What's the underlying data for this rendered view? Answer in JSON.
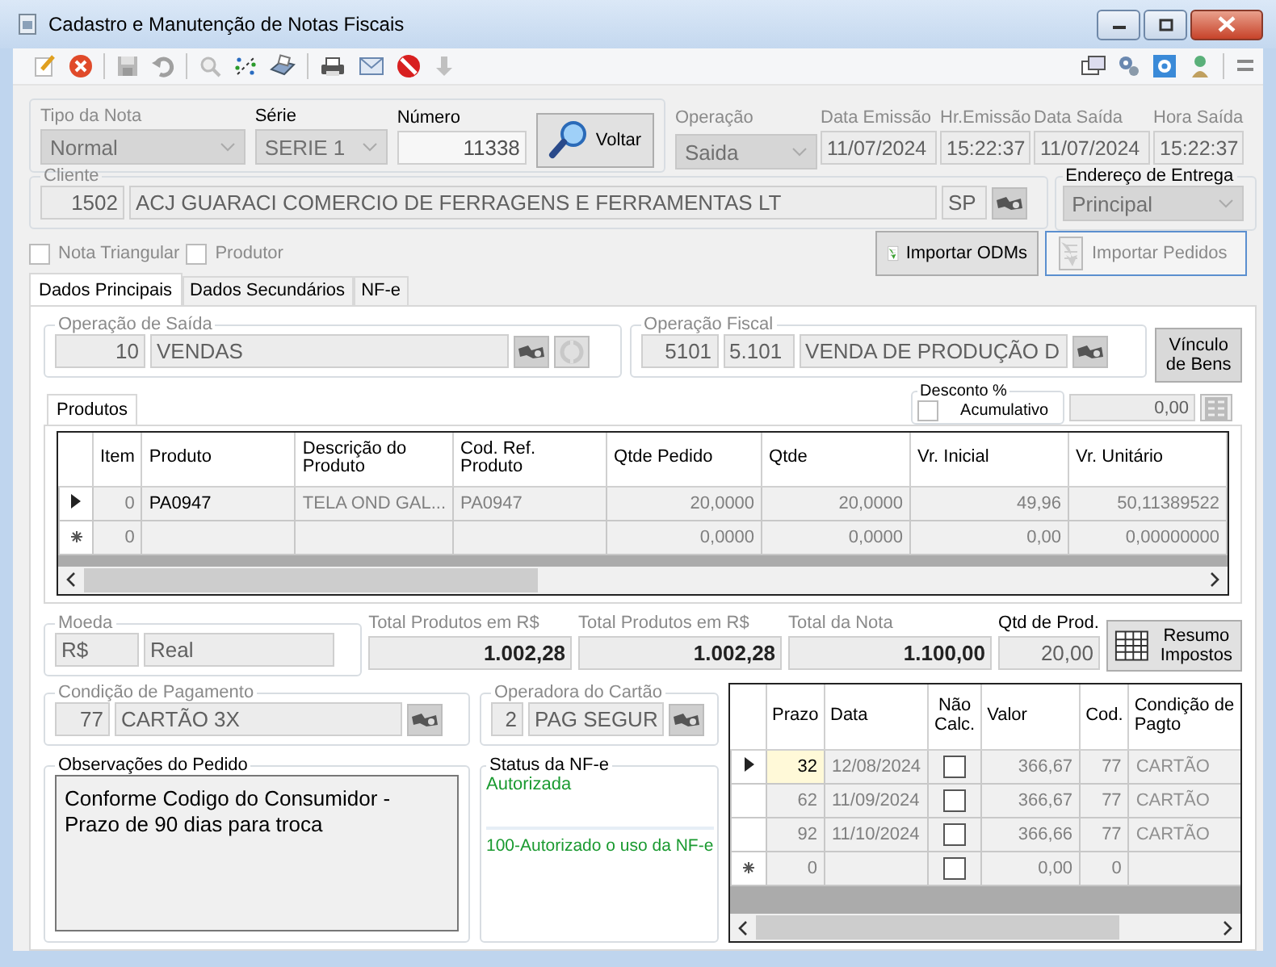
{
  "window": {
    "title": "Cadastro e Manutenção de Notas Fiscais"
  },
  "nota": {
    "fields": [
      {
        "label": "Tipo da Nota",
        "value": "Normal",
        "kind": "combo",
        "disabled": true
      },
      {
        "label": "Série",
        "value": "SERIE 1",
        "kind": "combo",
        "disabled": false
      },
      {
        "label": "Número",
        "value": "11338",
        "kind": "number",
        "disabled": false
      }
    ],
    "voltar_button": "Voltar"
  },
  "emissao_fields": [
    {
      "label": "Operação",
      "value": "Saida",
      "kind": "combo",
      "disabled": true
    },
    {
      "label": "Data Emissão",
      "value": "11/07/2024",
      "kind": "text",
      "disabled": true
    },
    {
      "label": "Hr.Emissão",
      "value": "15:22:37",
      "kind": "text",
      "disabled": true
    },
    {
      "label": "Data Saída",
      "value": "11/07/2024",
      "kind": "text",
      "disabled": true
    },
    {
      "label": "Hora Saída",
      "value": "15:22:37",
      "kind": "text",
      "disabled": true
    }
  ],
  "cliente": {
    "legend": "Cliente",
    "code": "1502",
    "name": "ACJ GUARACI COMERCIO DE FERRAGENS E FERRAMENTAS LT",
    "uf": "SP"
  },
  "endereco_entrega": {
    "legend": "Endereço de Entrega",
    "value": "Principal"
  },
  "options": [
    {
      "label": "Nota Triangular",
      "checked": false
    },
    {
      "label": "Produtor",
      "checked": false
    }
  ],
  "import_buttons": [
    {
      "label": "Importar ODMs",
      "disabled": false
    },
    {
      "label": "Importar Pedidos",
      "disabled": true
    }
  ],
  "tabs": [
    {
      "label": "Dados Principais",
      "selected": true
    },
    {
      "label": "Dados Secundários",
      "selected": false
    },
    {
      "label": "NF-e",
      "selected": false
    }
  ],
  "operacao_saida": {
    "legend": "Operação de Saída",
    "code": "10",
    "name": "VENDAS"
  },
  "operacao_fiscal": {
    "legend": "Operação Fiscal",
    "code": "5101",
    "cfop": "5.101",
    "name": "VENDA DE PRODUÇÃO D"
  },
  "vinculo_button": "Vínculo de Bens",
  "produtos": {
    "tab": "Produtos",
    "desconto": {
      "legend": "Desconto %",
      "label": "Acumulativo",
      "checked": false,
      "value": "0,00"
    },
    "columns": [
      "Item",
      "Produto",
      "Descrição do Produto",
      "Cod. Ref. Produto",
      "Qtde Pedido",
      "Qtde",
      "Vr. Inicial",
      "Vr. Unitário"
    ],
    "rows": [
      {
        "kind": "current",
        "cells": [
          "0",
          "PA0947",
          "TELA OND GAL...",
          "PA0947",
          "20,0000",
          "20,0000",
          "49,96",
          "50,11389522"
        ]
      },
      {
        "kind": "new",
        "cells": [
          "0",
          "",
          "",
          "",
          "0,0000",
          "0,0000",
          "0,00",
          "0,00000000"
        ]
      }
    ]
  },
  "moeda": {
    "legend": "Moeda",
    "code": "R$",
    "name": "Real"
  },
  "totals": [
    {
      "label": "Total Produtos em R$",
      "value": "1.002,28"
    },
    {
      "label": "Total Produtos em R$",
      "value": "1.002,28"
    },
    {
      "label": "Total da Nota",
      "value": "1.100,00"
    }
  ],
  "qtd_prod": {
    "label": "Qtd de Prod.",
    "value": "20,00"
  },
  "resumo_button": "Resumo Impostos",
  "condicao_pagamento": {
    "legend": "Condição de Pagamento",
    "code": "77",
    "name": "CARTÃO 3X"
  },
  "operadora_cartao": {
    "legend": "Operadora do Cartão",
    "code": "2",
    "name": "PAG SEGUR"
  },
  "observacoes": {
    "legend": "Observações do Pedido",
    "text": "Conforme Codigo do Consumidor - Prazo de 90 dias para troca"
  },
  "status_nfe": {
    "legend": "Status da NF-e",
    "status": "Autorizada",
    "message": "100-Autorizado o uso da NF-e"
  },
  "parcelas": {
    "columns": [
      "Prazo",
      "Data",
      "Não Calc.",
      "Valor",
      "Cod.",
      "Condição de Pagto"
    ],
    "rows": [
      {
        "kind": "current",
        "prazo": "32",
        "data": "12/08/2024",
        "nao_calc": false,
        "valor": "366,67",
        "cod": "77",
        "condicao": "CARTÃO"
      },
      {
        "kind": "plain",
        "prazo": "62",
        "data": "11/09/2024",
        "nao_calc": false,
        "valor": "366,67",
        "cod": "77",
        "condicao": "CARTÃO"
      },
      {
        "kind": "plain",
        "prazo": "92",
        "data": "11/10/2024",
        "nao_calc": false,
        "valor": "366,66",
        "cod": "77",
        "condicao": "CARTÃO"
      },
      {
        "kind": "new",
        "prazo": "0",
        "data": "",
        "nao_calc": false,
        "valor": "0,00",
        "cod": "0",
        "condicao": ""
      }
    ]
  }
}
